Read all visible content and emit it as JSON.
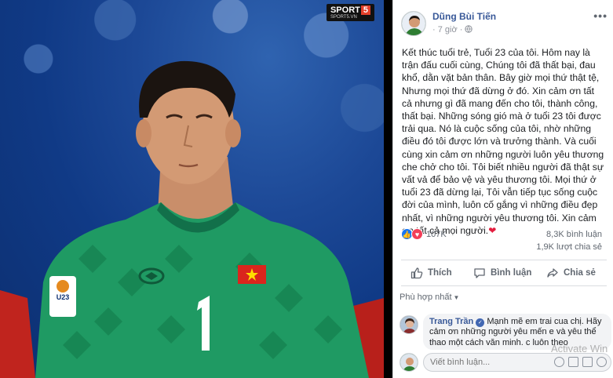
{
  "photo": {
    "brand": "SPORT",
    "brand_number": "5",
    "brand_site": "SPORT5.VN",
    "badge_text": "U23",
    "jersey_number": "1"
  },
  "post": {
    "author": "Dũng Bùi Tiến",
    "time": "7 giờ",
    "privacy_icon": "globe-icon",
    "more_label": "•••",
    "text": "Kết thúc tuổi trẻ, Tuổi 23 của tôi. Hôm nay là trận đấu cuối cùng, Chúng tôi đã thất bại, đau khổ, dằn vặt bản thân. Bây giờ mọi thứ thật tệ, Nhưng mọi thứ đã dừng ở đó. Xin cảm ơn tất cả nhưng gì đã mang đến cho tôi, thành công, thất bại. Những sóng gió mà ở tuổi 23 tôi được trải qua. Nó là cuộc sống của tôi, nhờ những điều đó tôi được lớn và trưởng thành. Và cuối cùng xin cảm ơn những người luôn yêu thương che chở cho tôi. Tôi biết nhiều người đã thật sự vất vả để bảo vệ và yêu thương tôi. Mọi thứ ở tuổi 23 đã dừng lại, Tôi vẫn tiếp tục sống cuộc đời của mình, luôn cố gắng vì những điều đẹp nhất, vì những người yêu thương tôi. Xin cảm ơn tất cả mọi người.",
    "heart": "❤"
  },
  "stats": {
    "reactions": "107K",
    "comments": "8,3K bình luận",
    "shares": "1,9K lượt chia sẻ"
  },
  "actions": {
    "like": "Thích",
    "comment": "Bình luận",
    "share": "Chia sẻ"
  },
  "sort": {
    "label": "Phù hợp nhất"
  },
  "comment": {
    "name": "Trang Trần",
    "text": "Mạnh mẽ em trai cua chị. Hãy cảm ơn những người yêu mến e và yêu thể thao một cách văn minh. c luôn theo"
  },
  "composer": {
    "placeholder": "Viết bình luận..."
  },
  "watermark": "Activate Win",
  "colors": {
    "link": "#385898",
    "reaction_like": "#1877f2",
    "reaction_love": "#f33e58",
    "jersey": "#1f9a63"
  }
}
